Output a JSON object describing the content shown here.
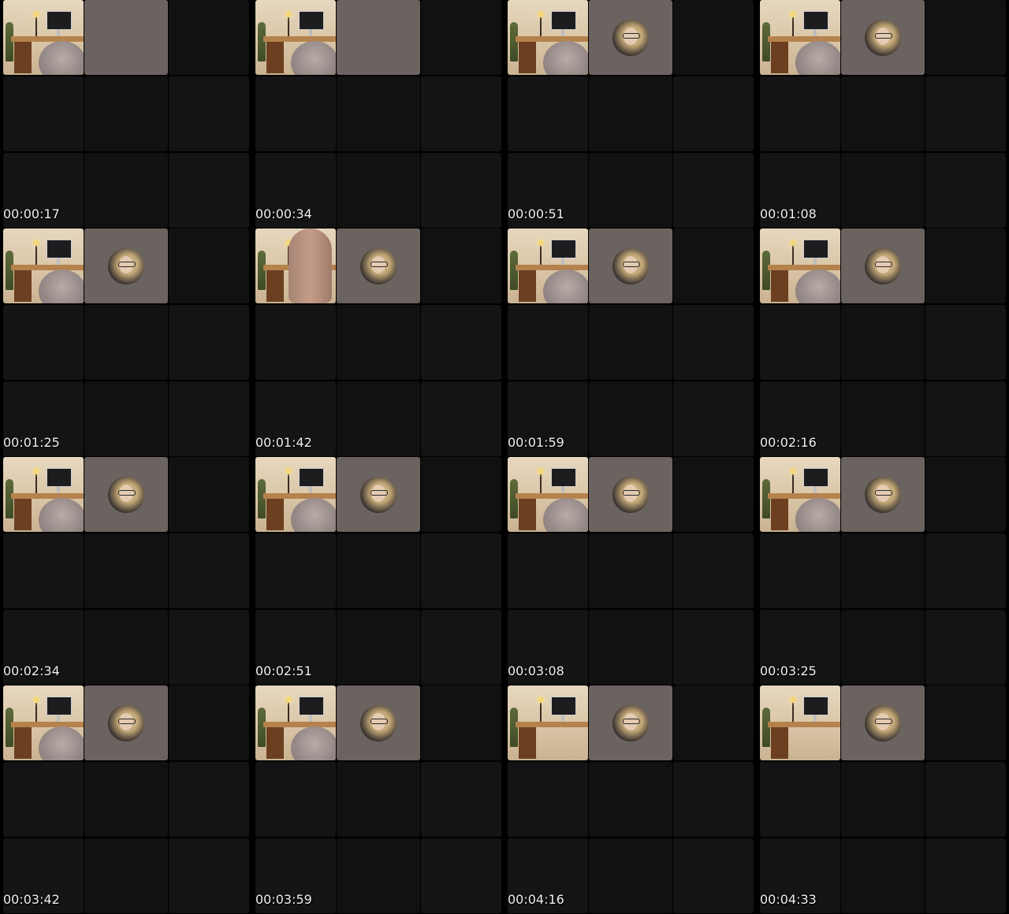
{
  "contact_sheet": {
    "thumbnails": [
      {
        "timestamp": "00:00:17",
        "camera_view": "head",
        "avatar_visible": false
      },
      {
        "timestamp": "00:00:34",
        "camera_view": "head",
        "avatar_visible": false
      },
      {
        "timestamp": "00:00:51",
        "camera_view": "head",
        "avatar_visible": true
      },
      {
        "timestamp": "00:01:08",
        "camera_view": "head",
        "avatar_visible": true
      },
      {
        "timestamp": "00:01:25",
        "camera_view": "head",
        "avatar_visible": true
      },
      {
        "timestamp": "00:01:42",
        "camera_view": "hand",
        "avatar_visible": true
      },
      {
        "timestamp": "00:01:59",
        "camera_view": "head",
        "avatar_visible": true
      },
      {
        "timestamp": "00:02:16",
        "camera_view": "head",
        "avatar_visible": true
      },
      {
        "timestamp": "00:02:34",
        "camera_view": "head",
        "avatar_visible": true
      },
      {
        "timestamp": "00:02:51",
        "camera_view": "head",
        "avatar_visible": true
      },
      {
        "timestamp": "00:03:08",
        "camera_view": "head",
        "avatar_visible": true
      },
      {
        "timestamp": "00:03:25",
        "camera_view": "head",
        "avatar_visible": true
      },
      {
        "timestamp": "00:03:42",
        "camera_view": "head",
        "avatar_visible": true
      },
      {
        "timestamp": "00:03:59",
        "camera_view": "head",
        "avatar_visible": true
      },
      {
        "timestamp": "00:04:16",
        "camera_view": "desk",
        "avatar_visible": true
      },
      {
        "timestamp": "00:04:33",
        "camera_view": "desk",
        "avatar_visible": true
      }
    ]
  },
  "colors": {
    "background": "#000000",
    "empty_tile": "#151414",
    "avatar_tile": "#6a6360",
    "timestamp_text": "#f0f0f0"
  }
}
